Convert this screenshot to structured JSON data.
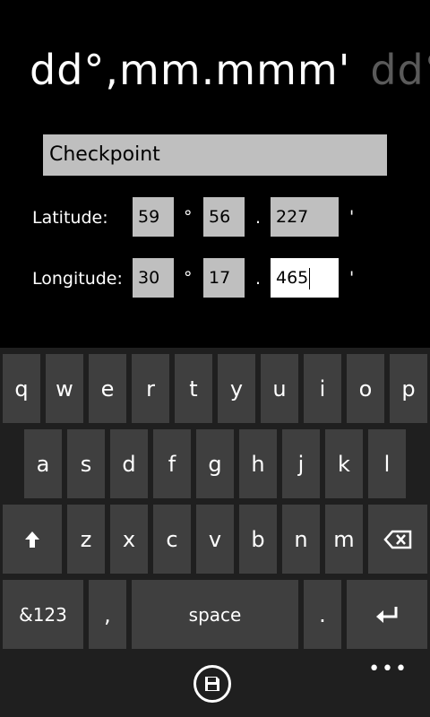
{
  "pivot": {
    "current": "dd°,mm.mmm'",
    "next": "dd°,mm.mmm'"
  },
  "waypoint_name": "Checkpoint",
  "latitude": {
    "label": "Latitude:",
    "degrees": "59",
    "deg_symbol": "°",
    "minutes": "56",
    "dot": ".",
    "fraction": "227",
    "min_symbol": "'"
  },
  "longitude": {
    "label": "Longitude:",
    "degrees": "30",
    "deg_symbol": "°",
    "minutes": "17",
    "dot": ".",
    "fraction": "465",
    "min_symbol": "'"
  },
  "keyboard": {
    "row1": [
      "q",
      "w",
      "e",
      "r",
      "t",
      "y",
      "u",
      "i",
      "o",
      "p"
    ],
    "row2": [
      "a",
      "s",
      "d",
      "f",
      "g",
      "h",
      "j",
      "k",
      "l"
    ],
    "row3": [
      "z",
      "x",
      "c",
      "v",
      "b",
      "n",
      "m"
    ],
    "symbols": "&123",
    "comma": ",",
    "space": "space",
    "period": "."
  },
  "appbar": {
    "save_icon": "save-icon",
    "more": "•••"
  }
}
